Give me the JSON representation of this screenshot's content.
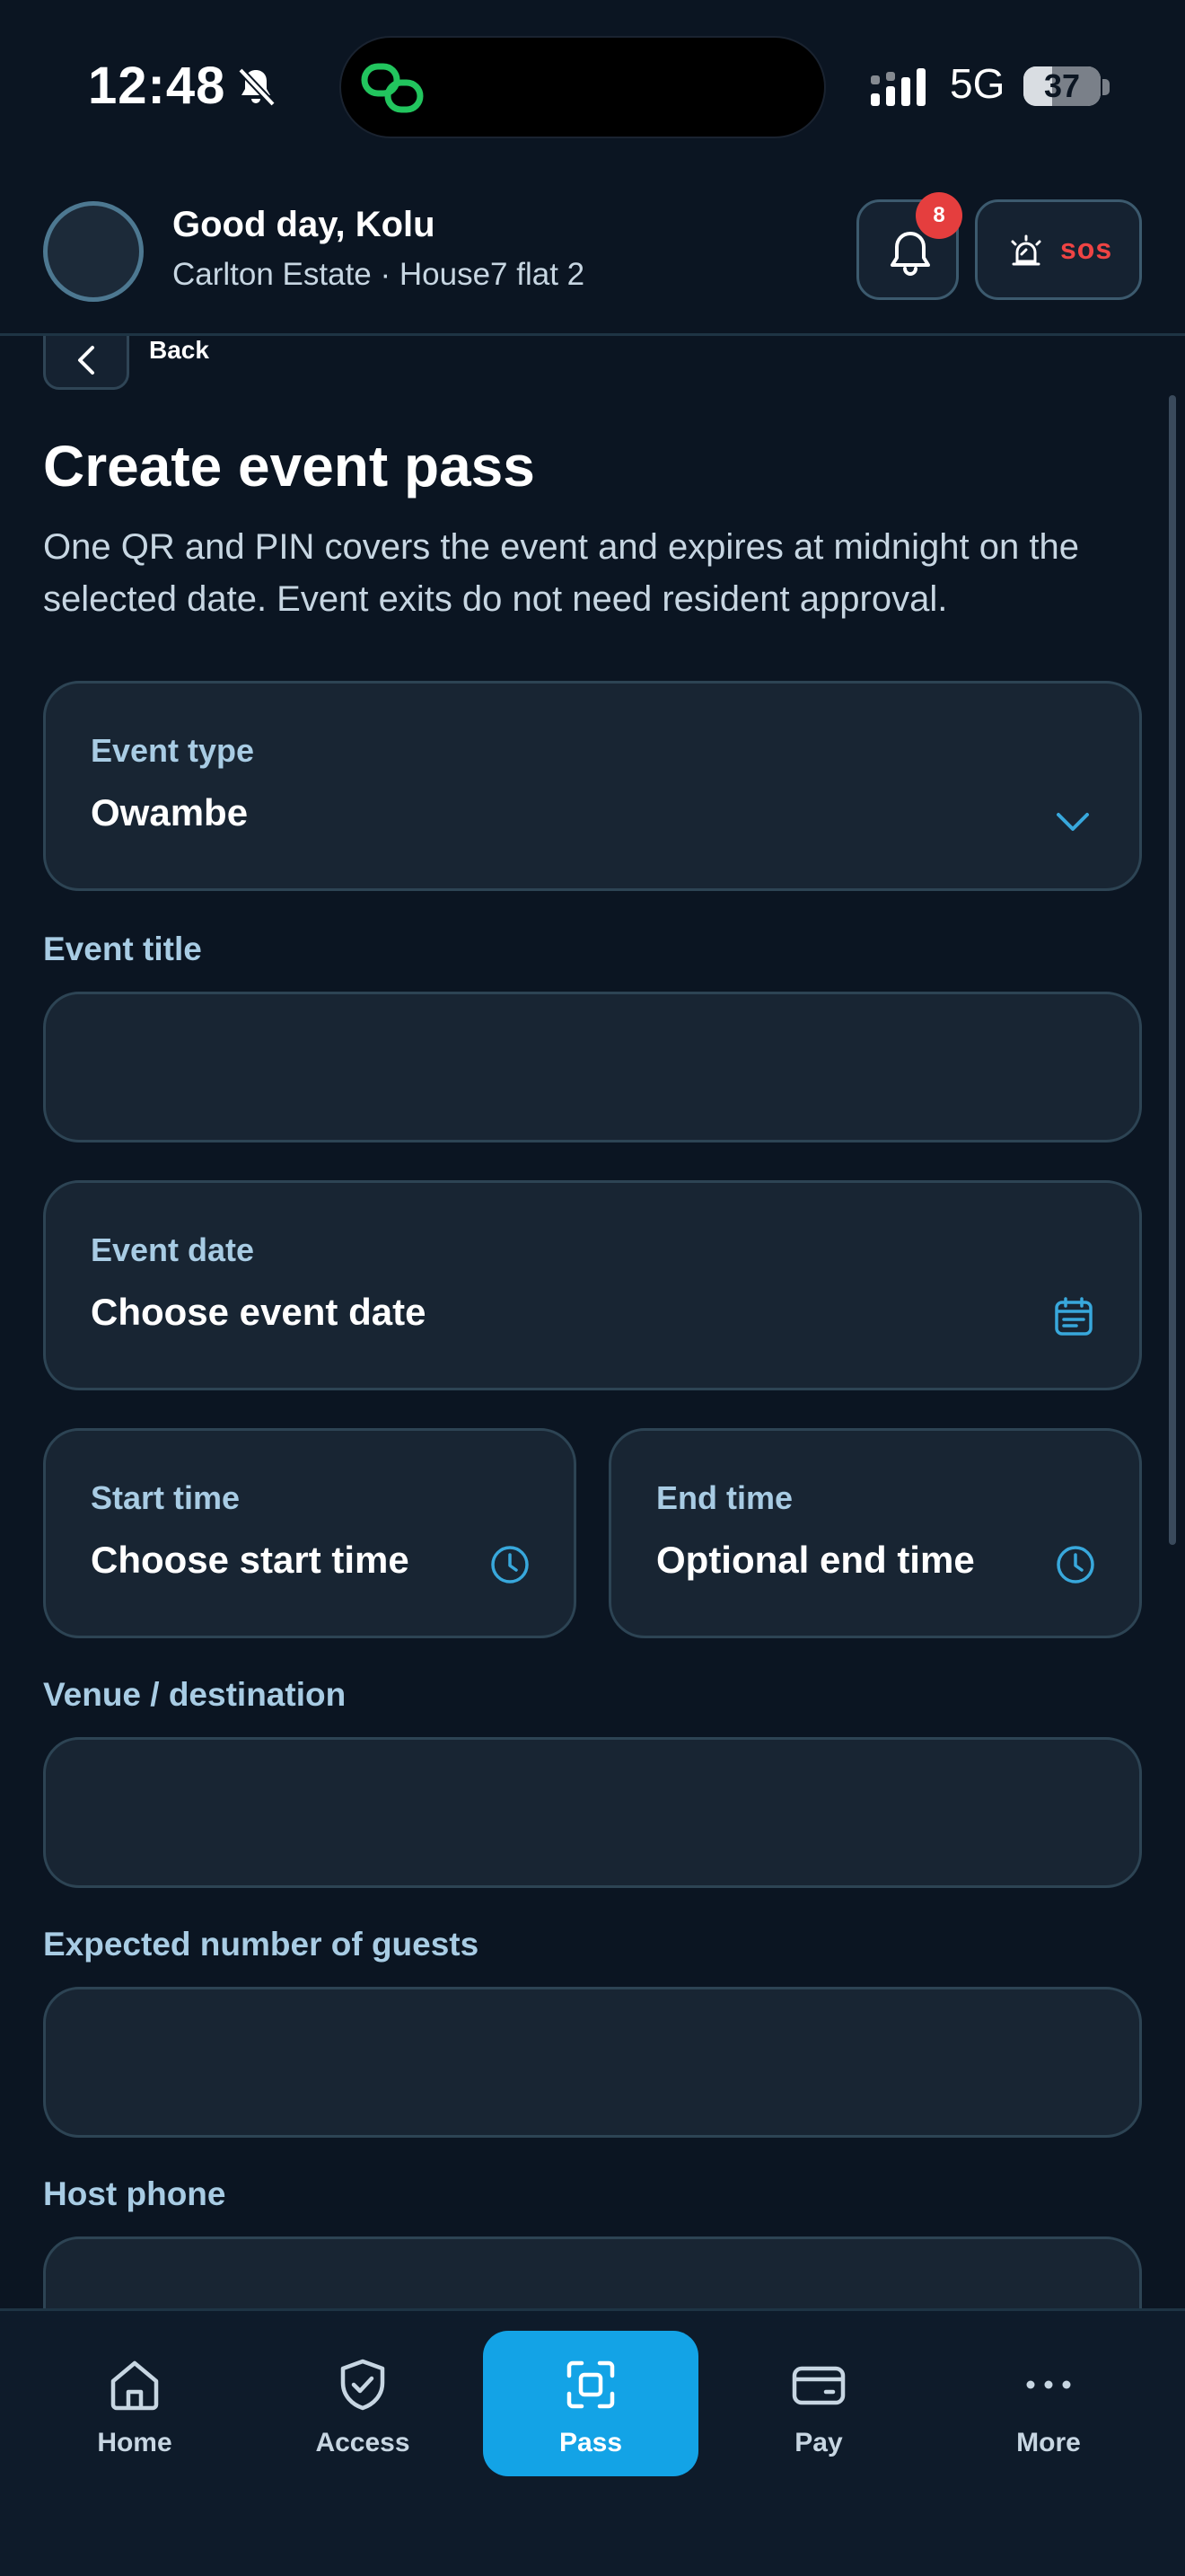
{
  "status_bar": {
    "time": "12:48",
    "network": "5G",
    "battery": "37",
    "battery_level": 0.37
  },
  "header": {
    "greeting": "Good day, Kolu",
    "estate": "Carlton Estate · House7 flat 2",
    "notification_count": "8",
    "sos_label": "sos"
  },
  "back_label": "Back",
  "page": {
    "title": "Create event pass",
    "description": "One QR and PIN covers the event and expires at midnight on the selected date. Event exits do not need resident approval."
  },
  "form": {
    "event_type": {
      "label": "Event type",
      "value": "Owambe"
    },
    "event_title": {
      "label": "Event title",
      "value": ""
    },
    "event_date": {
      "label": "Event date",
      "value": "Choose event date"
    },
    "start_time": {
      "label": "Start time",
      "value": "Choose start time"
    },
    "end_time": {
      "label": "End time",
      "value": "Optional end time"
    },
    "venue": {
      "label": "Venue / destination",
      "value": ""
    },
    "guests": {
      "label": "Expected number of guests",
      "value": ""
    },
    "host_phone": {
      "label": "Host phone",
      "value": ""
    }
  },
  "nav": {
    "items": [
      {
        "label": "Home",
        "icon": "home-icon"
      },
      {
        "label": "Access",
        "icon": "shield-check-icon"
      },
      {
        "label": "Pass",
        "icon": "scan-icon",
        "active": true
      },
      {
        "label": "Pay",
        "icon": "wallet-icon"
      },
      {
        "label": "More",
        "icon": "more-icon"
      }
    ]
  },
  "colors": {
    "background": "#0b1522",
    "card": "#182533",
    "accent": "#13a3e6",
    "label": "#a8cce4",
    "sos": "#ef4444",
    "badge": "#e53e3e",
    "link_icon": "#22c55e"
  }
}
